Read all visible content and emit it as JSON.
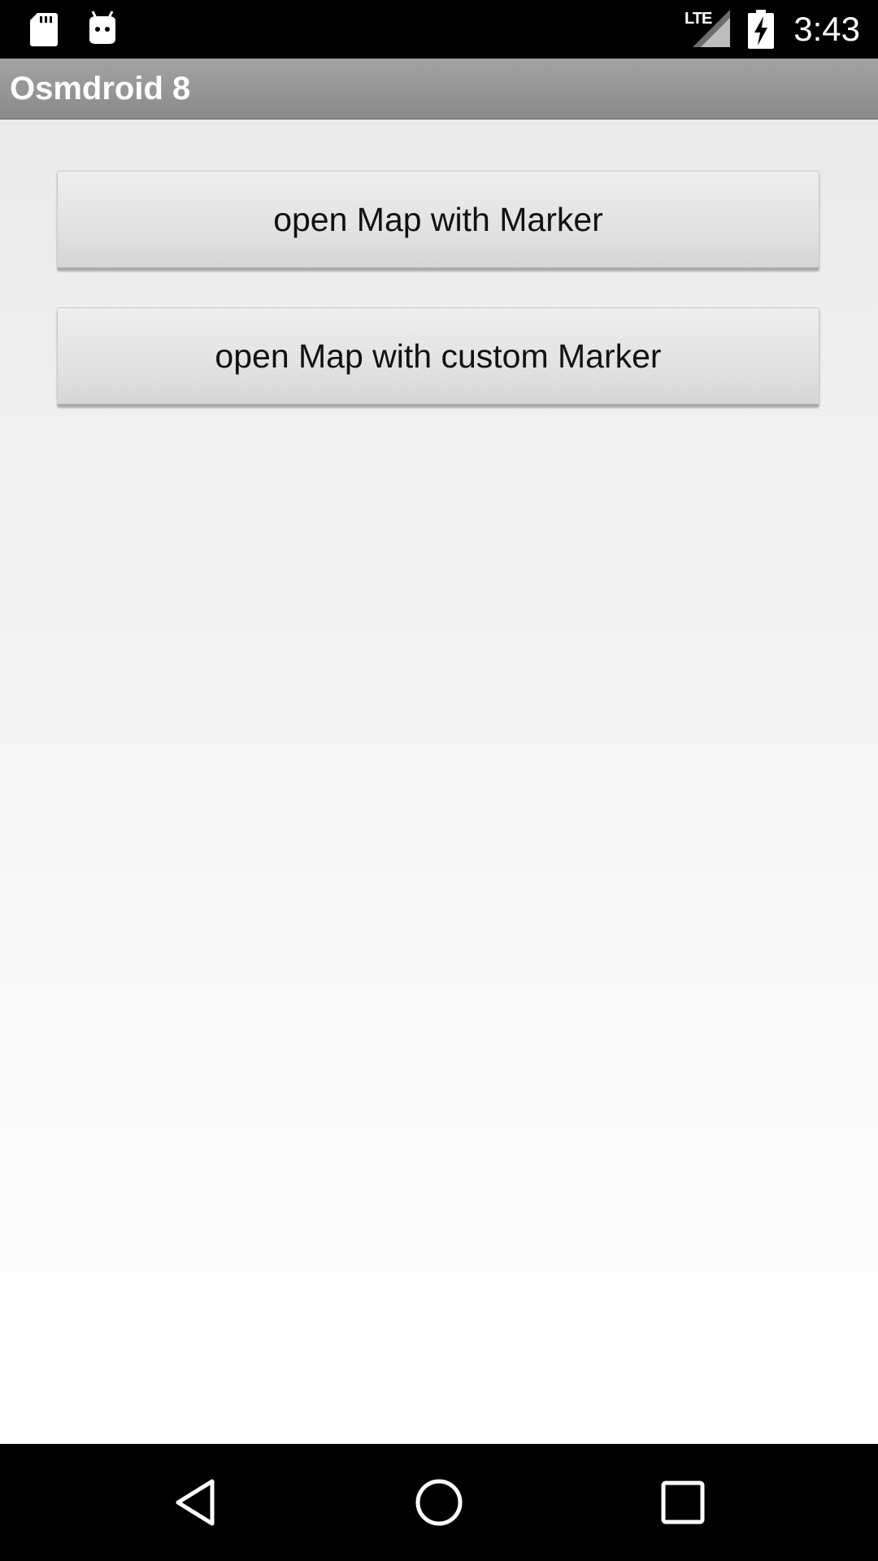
{
  "status_bar": {
    "clock": "3:43",
    "network_label": "LTE",
    "icons": [
      "sd-card-icon",
      "android-debug-icon",
      "signal-icon",
      "battery-charging-icon"
    ]
  },
  "action_bar": {
    "title": "Osmdroid 8"
  },
  "buttons": [
    {
      "label": "open Map with Marker"
    },
    {
      "label": "open Map with custom Marker"
    }
  ],
  "nav_bar": {
    "icons": [
      "back-icon",
      "home-icon",
      "recents-icon"
    ]
  }
}
